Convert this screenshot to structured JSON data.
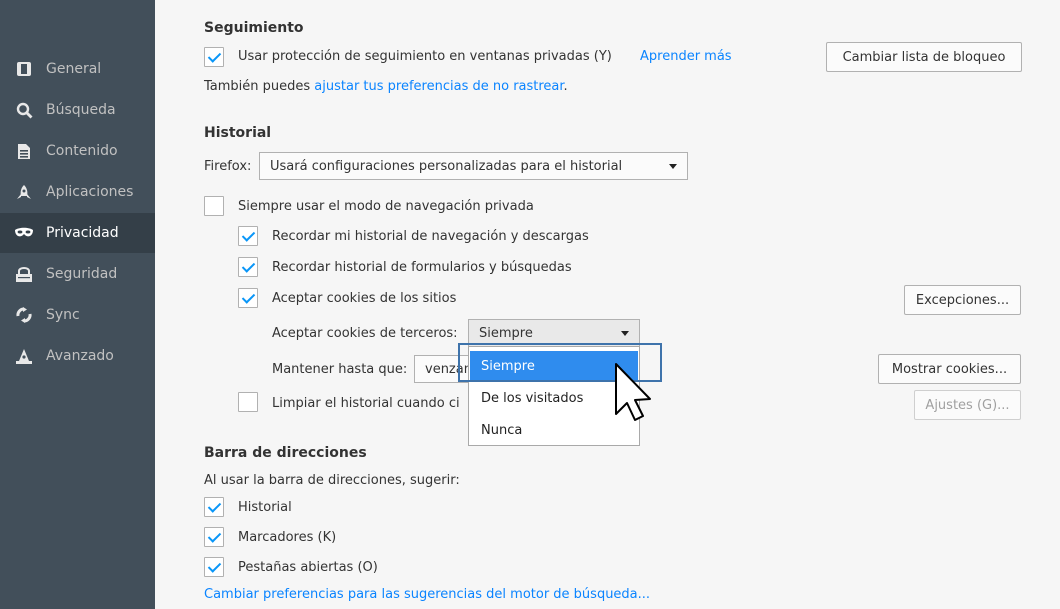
{
  "sidebar": {
    "items": [
      {
        "label": "General",
        "icon": "general-icon",
        "active": false
      },
      {
        "label": "Búsqueda",
        "icon": "search-icon",
        "active": false
      },
      {
        "label": "Contenido",
        "icon": "document-icon",
        "active": false
      },
      {
        "label": "Aplicaciones",
        "icon": "rocket-icon",
        "active": false
      },
      {
        "label": "Privacidad",
        "icon": "mask-icon",
        "active": true
      },
      {
        "label": "Seguridad",
        "icon": "lock-icon",
        "active": false
      },
      {
        "label": "Sync",
        "icon": "sync-icon",
        "active": false
      },
      {
        "label": "Avanzado",
        "icon": "wizard-hat-icon",
        "active": false
      }
    ]
  },
  "tracking": {
    "heading": "Seguimiento",
    "private_label": "Usar protección de seguimiento en ventanas privadas (Y)",
    "learn_more": "Aprender más",
    "change_blocklist": "Cambiar lista de bloqueo",
    "also_prefix": "También puedes ",
    "dnt_link": "ajustar tus preferencias de no rastrear",
    "also_suffix": "."
  },
  "history": {
    "heading": "Historial",
    "firefox_label": "Firefox:",
    "mode_value": "Usará configuraciones personalizadas para el historial",
    "always_private": "Siempre usar el modo de navegación privada",
    "remember_browsing": "Recordar mi historial de navegación y descargas",
    "remember_forms": "Recordar historial de formularios y búsquedas",
    "accept_cookies": "Aceptar cookies de los sitios",
    "exceptions": "Excepciones...",
    "third_party_label": "Aceptar cookies de terceros:",
    "third_party_value": "Siempre",
    "keep_until_label": "Mantener hasta que:",
    "keep_until_value": "venzan",
    "show_cookies": "Mostrar cookies...",
    "clear_on_close": "Limpiar el historial cuando ci",
    "settings": "Ajustes (G)...",
    "dropdown_options": [
      "Siempre",
      "De los visitados",
      "Nunca"
    ]
  },
  "addressbar": {
    "heading": "Barra de direcciones",
    "suggest_label": "Al usar la barra de direcciones, sugerir:",
    "history": "Historial",
    "bookmarks": "Marcadores (K)",
    "open_tabs": "Pestañas abiertas (O)",
    "search_suggestions_link": "Cambiar preferencias para las sugerencias del motor de búsqueda..."
  },
  "colors": {
    "sidebar_bg": "#424f5a",
    "sidebar_active": "#343f48",
    "accent": "#0a84ff",
    "selected_option": "#2f8cee"
  }
}
